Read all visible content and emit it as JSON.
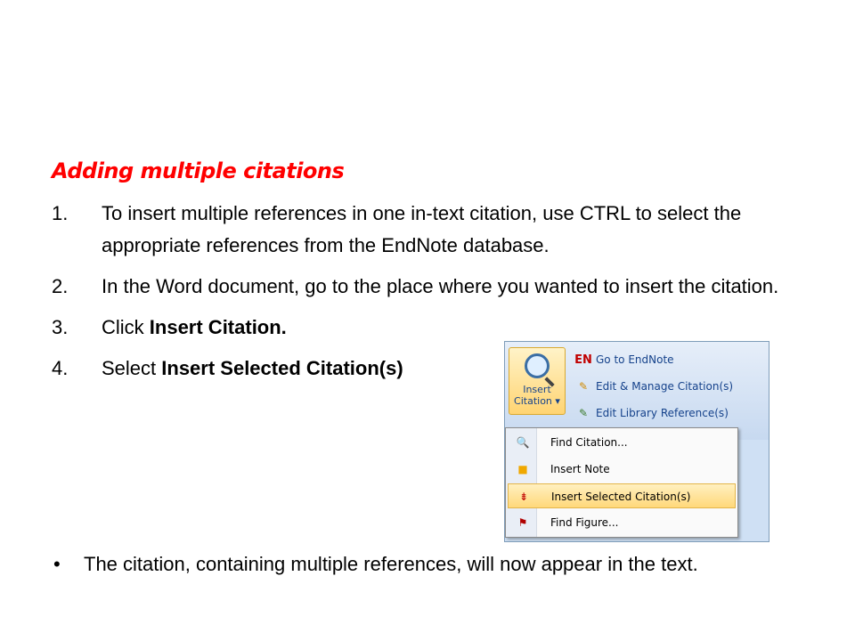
{
  "heading": "Adding multiple citations",
  "steps": [
    {
      "num": "1.",
      "text": "To insert multiple references in one in-text citation, use CTRL to select the appropriate references from the EndNote database."
    },
    {
      "num": "2.",
      "text": "In the Word document, go to the place where you wanted to insert the citation."
    },
    {
      "num": "3.",
      "prefix": "Click ",
      "bold": "Insert Citation."
    },
    {
      "num": "4.",
      "prefix": "Select ",
      "bold": "Insert Selected Citation(s)"
    }
  ],
  "bullet": {
    "symbol": "•",
    "text": "The citation, containing multiple references, will now appear in the text."
  },
  "screenshot": {
    "insert_button_line1": "Insert",
    "insert_button_line2": "Citation ▾",
    "ribbon_items": [
      {
        "icon": "EN",
        "label": "Go to EndNote"
      },
      {
        "icon": "✎",
        "label": "Edit & Manage Citation(s)"
      },
      {
        "icon": "✎",
        "label": "Edit Library Reference(s)"
      }
    ],
    "menu_items": [
      {
        "icon": "🔍",
        "label": "Find Citation..."
      },
      {
        "icon": "■",
        "label": "Insert Note"
      },
      {
        "icon": "⇟",
        "label": "Insert Selected Citation(s)"
      },
      {
        "icon": "⚑",
        "label": "Find Figure..."
      }
    ]
  },
  "colors": {
    "heading": "#ff0000",
    "ribbon_text": "#15428b",
    "highlight": "#ffd87a"
  }
}
